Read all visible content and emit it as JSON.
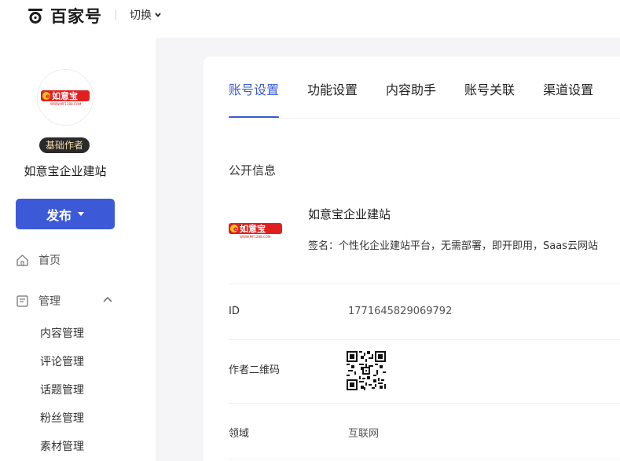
{
  "header": {
    "logo_text": "百家号",
    "switch_label": "切换"
  },
  "sidebar": {
    "brand_logo_text": "如意宝",
    "brand_logo_sub": "WWW.MF1288.COM",
    "badge": "基础作者",
    "account_name": "如意宝企业建站",
    "publish_label": "发布",
    "home_label": "首页",
    "manage_label": "管理",
    "sub_items": [
      "内容管理",
      "评论管理",
      "话题管理",
      "粉丝管理",
      "素材管理"
    ]
  },
  "main": {
    "tabs": [
      "账号设置",
      "功能设置",
      "内容助手",
      "账号关联",
      "渠道设置"
    ],
    "active_tab": 0,
    "section_title": "公开信息",
    "profile": {
      "logo_text": "如意宝",
      "logo_sub": "WWW.MF1288.COM",
      "name": "如意宝企业建站",
      "signature": "签名：个性化企业建站平台，无需部署，即开即用，Saas云网站"
    },
    "rows": {
      "id_label": "ID",
      "id_value": "1771645829069792",
      "qr_label": "作者二维码",
      "domain_label": "领域",
      "domain_value": "互联网"
    }
  },
  "colors": {
    "accent": "#3c5ad8",
    "brand_red": "#e02020",
    "badge_bg": "#2a2a2a"
  }
}
